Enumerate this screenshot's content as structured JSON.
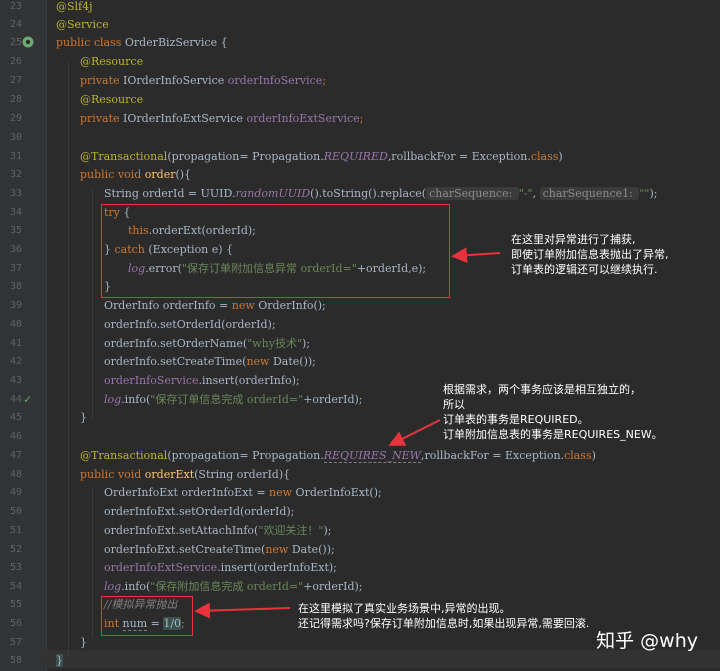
{
  "line_numbers": [
    "23",
    "24",
    "25",
    "26",
    "27",
    "28",
    "29",
    "30",
    "31",
    "32",
    "33",
    "34",
    "35",
    "36",
    "37",
    "38",
    "39",
    "40",
    "41",
    "42",
    "43",
    "44",
    "45",
    "46",
    "47",
    "48",
    "49",
    "50",
    "51",
    "52",
    "53",
    "54",
    "55",
    "56",
    "57",
    "58"
  ],
  "code": {
    "l23": "@Slf4j",
    "l24": "@Service",
    "l25_kw": "public class ",
    "l25_name": "OrderBizService {",
    "l26": "@Resource",
    "l27_kw": "private ",
    "l27_type": "IOrderInfoService ",
    "l27_f": "orderInfoService",
    "l27_end": ";",
    "l28": "@Resource",
    "l29_kw": "private ",
    "l29_type": "IOrderInfoExtService ",
    "l29_f": "orderInfoExtService",
    "l29_end": ";",
    "l31_a": "@Transactional",
    "l31_b": "(propagation= Propagation.",
    "l31_c": "REQUIRED",
    "l31_d": ",rollbackFor = Exception.",
    "l31_e": "class",
    "l31_f": ")",
    "l32_kw": "public void ",
    "l32_fn": "order",
    "l32_end": "(){",
    "l33_a": "String orderId = UUID.",
    "l33_b": "randomUUID",
    "l33_c": "().toString().replace(",
    "l33_h1": "charSequence: ",
    "l33_s1": "\"-\"",
    "l33_d": ", ",
    "l33_h2": "charSequence1: ",
    "l33_s2": "\"\"",
    "l33_e": ");",
    "l34_kw": "try",
    "l34_end": " {",
    "l35_kw": "this",
    "l35_end": ".orderExt(orderId);",
    "l36_a": "} ",
    "l36_kw": "catch",
    "l36_b": " (Exception e) {",
    "l37_f": "log",
    "l37_a": ".error(",
    "l37_s": "\"保存订单附加信息异常 orderId=\"",
    "l37_b": "+orderId,e);",
    "l38": "}",
    "l39_a": "OrderInfo orderInfo = ",
    "l39_kw": "new",
    "l39_b": " OrderInfo();",
    "l40": "orderInfo.setOrderId(orderId);",
    "l41_a": "orderInfo.setOrderName(",
    "l41_s": "\"why技术\"",
    "l41_b": ");",
    "l42_a": "orderInfo.setCreateTime(",
    "l42_kw": "new",
    "l42_b": " Date());",
    "l43_f": "orderInfoService",
    "l43_a": ".insert(orderInfo);",
    "l44_f": "log",
    "l44_a": ".info(",
    "l44_s": "\"保存订单信息完成 orderId=\"",
    "l44_b": "+orderId);",
    "l45": "}",
    "l47_a": "@Transactional",
    "l47_b": "(propagation= Propagation.",
    "l47_c": "REQUIRES_NEW",
    "l47_d": ",rollbackFor = Exception.",
    "l47_e": "class",
    "l47_f": ")",
    "l48_kw": "public void ",
    "l48_fn": "orderExt",
    "l48_end": "(String orderId){",
    "l49_a": "OrderInfoExt orderInfoExt = ",
    "l49_kw": "new",
    "l49_b": " OrderInfoExt();",
    "l50": "orderInfoExt.setOrderId(orderId);",
    "l51_a": "orderInfoExt.setAttachInfo(",
    "l51_s": "\"欢迎关注！\"",
    "l51_b": ");",
    "l52_a": "orderInfoExt.setCreateTime(",
    "l52_kw": "new",
    "l52_b": " Date());",
    "l53_f": "orderInfoExtService",
    "l53_a": ".insert(orderInfoExt);",
    "l54_f": "log",
    "l54_a": ".info(",
    "l54_s": "\"保存附加信息完成 orderId=\"",
    "l54_b": "+orderId);",
    "l55": "//模拟异常抛出",
    "l56_kw": "int ",
    "l56_v": "num",
    "l56_a": " = ",
    "l56_n": "1/0",
    "l56_b": ";",
    "l57": "}",
    "l58": "}"
  },
  "annotations": {
    "note1": "在这里对异常进行了捕获,\n即使订单附加信息表抛出了异常,\n订单表的逻辑还可以继续执行.",
    "note2": "根据需求，两个事务应该是相互独立的，\n所以\n订单表的事务是REQUIRED。\n订单附加信息表的事务是REQUIRES_NEW。",
    "note3": "在这里模拟了真实业务场景中,异常的出现。\n还记得需求吗?保存订单附加信息时,如果出现异常,需要回滚."
  },
  "watermark": "知乎 @why",
  "colors": {
    "bg": "#2b2b2b",
    "keyword": "#cc7832",
    "annotation": "#bbb529",
    "string": "#6a8759",
    "field": "#9876aa",
    "highlight_box": "#e8333c"
  }
}
